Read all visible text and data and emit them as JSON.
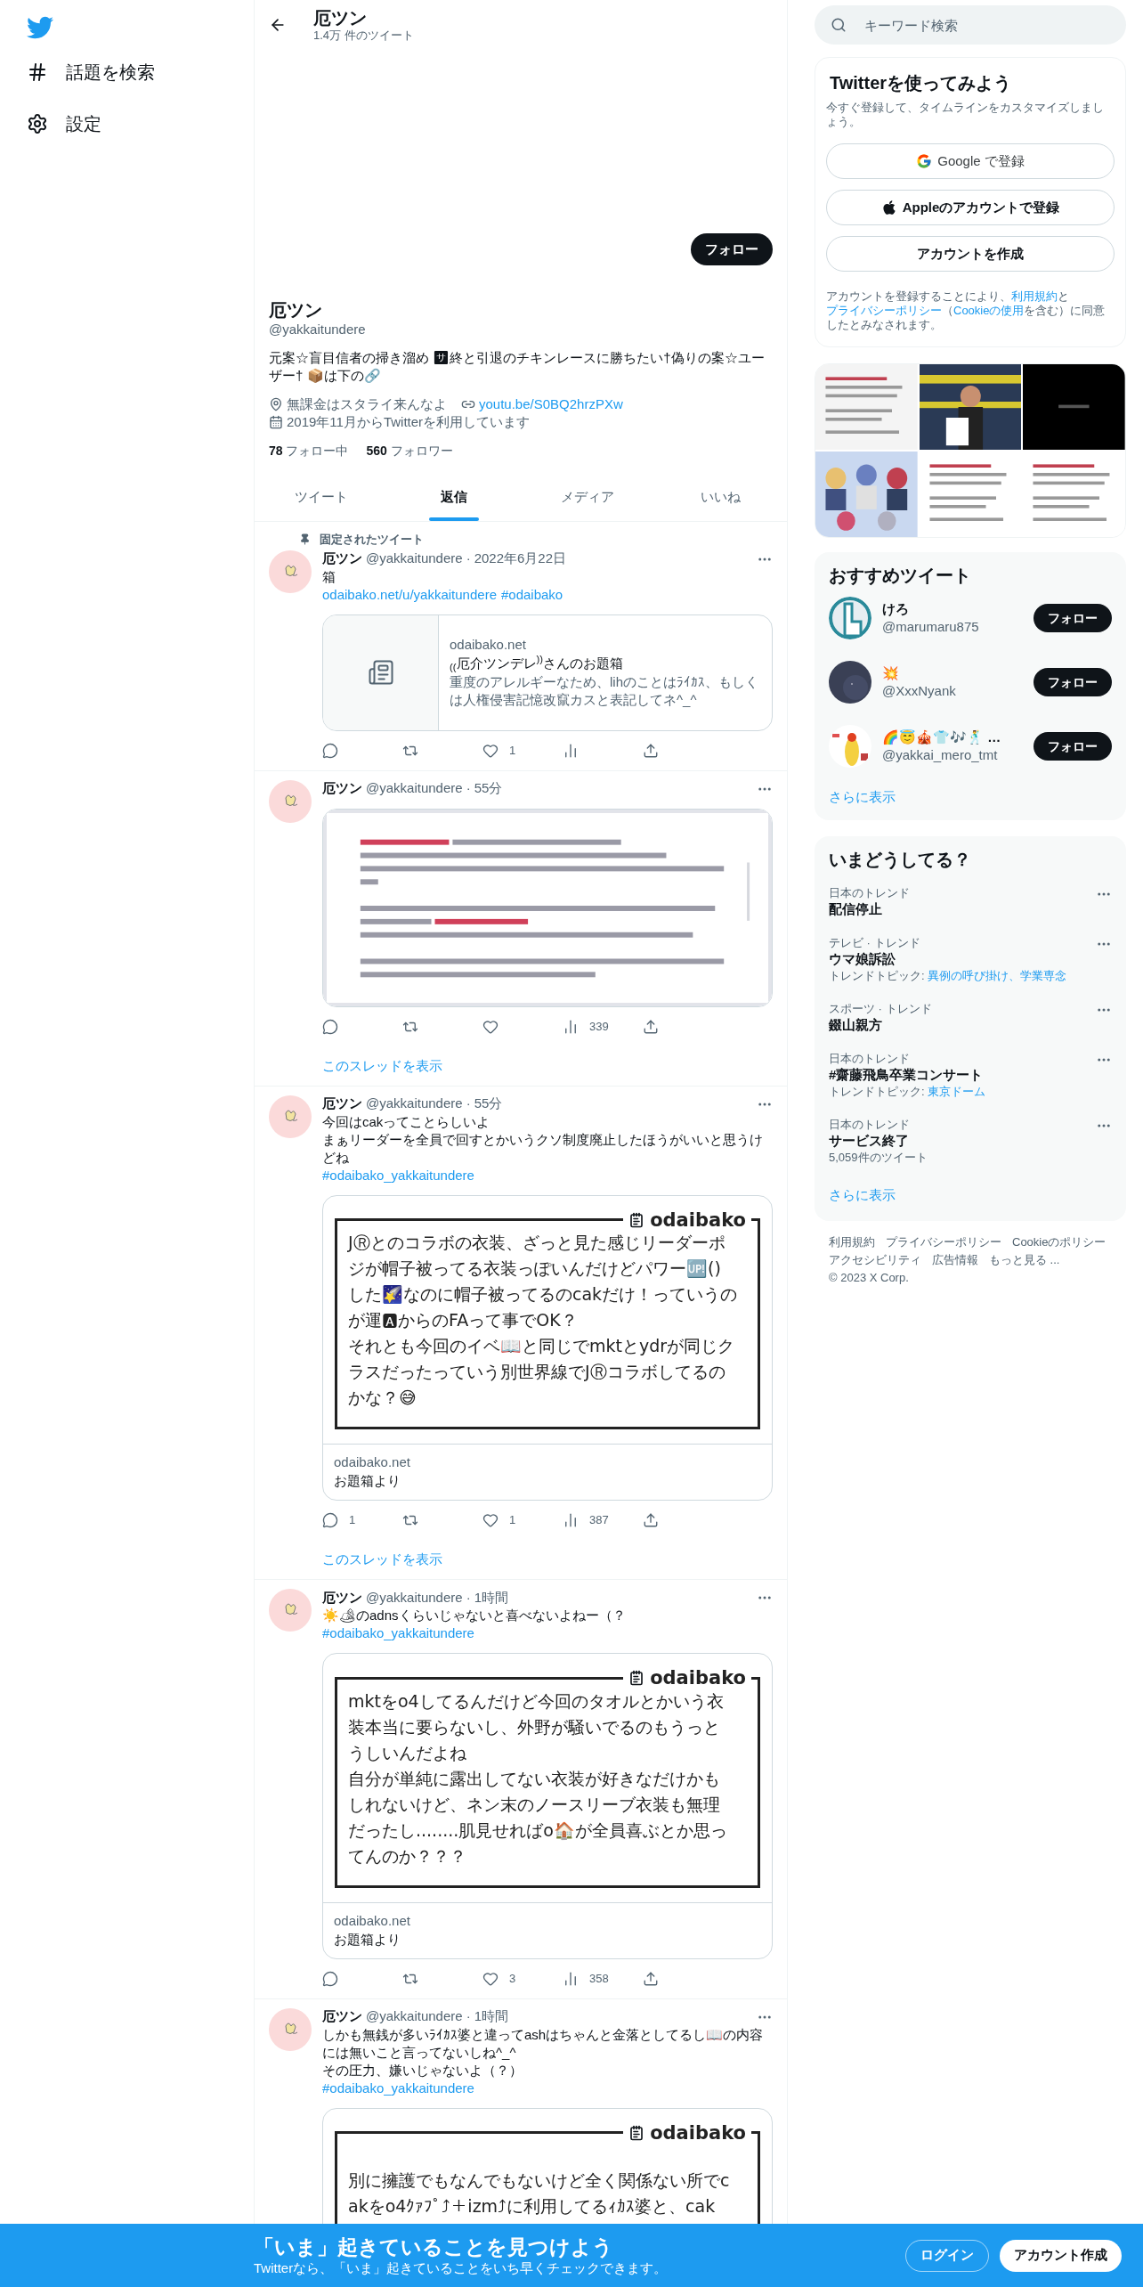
{
  "nav": {
    "items": [
      {
        "kind": "hash",
        "label": "話題を検索"
      },
      {
        "kind": "gear",
        "label": "設定"
      }
    ]
  },
  "header": {
    "title": "厄ツン",
    "subtitle": "1.4万 件のツイート"
  },
  "profile": {
    "follow_button": "フォロー",
    "name": "厄ツン",
    "handle": "@yakkaitundere",
    "bio": "元案☆盲目信者の掃き溜め 🈂終と引退のチキンレースに勝ちたい†偽りの案☆ユーザー† 📦は下の🔗",
    "location": "無課金はスタライ来んなよ",
    "link": "youtu.be/S0BQ2hrzPXw",
    "joined": "2019年11月からTwitterを利用しています",
    "stats": [
      {
        "count": "78",
        "label": "フォロー中"
      },
      {
        "count": "560",
        "label": "フォロワー"
      }
    ]
  },
  "tabs": [
    {
      "label": "ツイート",
      "selected": false
    },
    {
      "label": "返信",
      "selected": true
    },
    {
      "label": "メディア",
      "selected": false
    },
    {
      "label": "いいね",
      "selected": false
    }
  ],
  "tweets": [
    {
      "pinned_label": "固定されたツイート",
      "name": "厄ツン",
      "handle": "@yakkaitundere",
      "separator": "·",
      "time": "2022年6月22日",
      "lines": [
        "箱"
      ],
      "links": [
        "odaibako.net/u/yakkaitundere",
        "#odaibako"
      ],
      "card": {
        "kind": "link",
        "domain": "odaibako.net",
        "title": "$_{((}$厄介ツンデレ$^{))}$さんのお題箱",
        "description": "重度のアレルギーなため、lihのことはﾗｲｶｽ、もしくは人権侵害記憶改竄カスと表記してネ^_^"
      },
      "actions": [
        {
          "kind": "reply"
        },
        {
          "kind": "retweet"
        },
        {
          "kind": "like",
          "count": "1"
        },
        {
          "kind": "views"
        },
        {
          "kind": "share"
        }
      ]
    },
    {
      "name": "厄ツン",
      "handle": "@yakkaitundere",
      "separator": "·",
      "time": "55分",
      "card": {
        "kind": "picture"
      },
      "actions": [
        {
          "kind": "reply"
        },
        {
          "kind": "retweet"
        },
        {
          "kind": "like"
        },
        {
          "kind": "views",
          "count": "339"
        },
        {
          "kind": "share"
        }
      ],
      "thread_link": "このスレッドを表示"
    },
    {
      "name": "厄ツン",
      "handle": "@yakkaitundere",
      "separator": "·",
      "time": "55分",
      "lines": [
        "今回はcakってことらしいよ",
        "まぁリーダーを全員で回すとかいうクソ制度廃止したほうがいいと思うけどね"
      ],
      "hashtag": "#odaibako_yakkaitundere",
      "card": {
        "kind": "odaibako",
        "brand": "odaibako",
        "lines": [
          "JⓇとのコラボの衣装、ざっと見た感じリーダーポ",
          "ジが帽子被ってる衣装っぽいんだけどパワー🆙()",
          "した🌠なのに帽子被ってるのcakだけ！っていうの",
          "が運🅰からのFAって事でOK？",
          "それとも今回のイベ📖と同じでmktとydrが同じク",
          "ラスだったっていう別世界線でJⓇコラボしてるの",
          "かな？😅"
        ],
        "domain": "odaibako.net",
        "caption": "お題箱より"
      },
      "actions": [
        {
          "kind": "reply",
          "count": "1"
        },
        {
          "kind": "retweet"
        },
        {
          "kind": "like",
          "count": "1"
        },
        {
          "kind": "views",
          "count": "387"
        },
        {
          "kind": "share"
        }
      ],
      "thread_link": "このスレッドを表示"
    },
    {
      "name": "厄ツン",
      "handle": "@yakkaitundere",
      "separator": "·",
      "time": "1時間",
      "lines": [
        "☀️🏕のadnsくらいじゃないと喜べないよねー（？"
      ],
      "hashtag": "#odaibako_yakkaitundere",
      "card": {
        "kind": "odaibako",
        "brand": "odaibako",
        "lines": [
          "mktをo4してるんだけど今回のタオルとかいう衣",
          "装本当に要らないし、外野が騒いでるのもうっと",
          "うしいんだよね",
          "自分が単純に露出してない衣装が好きなだけかも",
          "しれないけど、ネン末のノースリーブ衣装も無理",
          "だったし........肌見せればo🏠が全員喜ぶとか思っ",
          "てんのか？？？"
        ],
        "domain": "odaibako.net",
        "caption": "お題箱より"
      },
      "actions": [
        {
          "kind": "reply"
        },
        {
          "kind": "retweet"
        },
        {
          "kind": "like",
          "count": "3"
        },
        {
          "kind": "views",
          "count": "358"
        },
        {
          "kind": "share"
        }
      ]
    },
    {
      "name": "厄ツン",
      "handle": "@yakkaitundere",
      "separator": "·",
      "time": "1時間",
      "lines": [
        "しかも無銭が多いﾗｲｶｽ婆と違ってashはちゃんと金落としてるし📖の内容には無いこと言ってないしね^_^",
        "その圧力、嫌いじゃないよ（？）"
      ],
      "hashtag": "#odaibako_yakkaitundere",
      "card": {
        "kind": "odaibako",
        "brand": "odaibako",
        "blank_first_line": true,
        "lines": [
          "別に擁護でもなんでもないけど全く関係ない所でc",
          "akをo4ｸｧﾌﾟ⤴＋izm⤴に利用してるｨｶｽ婆と、cak"
        ]
      }
    }
  ],
  "search": {
    "placeholder": "キーワード検索"
  },
  "signup": {
    "title": "Twitterを使ってみよう",
    "subtitle": "今すぐ登録して、タイムラインをカスタマイズしましょう。",
    "buttons": [
      {
        "kind": "google",
        "label": "Google で登録"
      },
      {
        "kind": "apple",
        "label": "Appleのアカウントで登録"
      },
      {
        "kind": "plain",
        "label": "アカウントを作成"
      }
    ],
    "legal": [
      {
        "text": "アカウントを登録することにより、",
        "link": false
      },
      {
        "text": "利用規約",
        "link": true
      },
      {
        "text": "と",
        "link": false
      },
      {
        "text": "プライバシーポリシー",
        "link": true
      },
      {
        "text": "（",
        "link": false
      },
      {
        "text": "Cookieの使用",
        "link": true
      },
      {
        "text": "を含む）に同意したとみなされます。",
        "link": false
      }
    ]
  },
  "media": [
    {
      "kind": "picture"
    },
    {
      "kind": "picture"
    },
    {
      "kind": "picture"
    },
    {
      "kind": "picture"
    },
    {
      "kind": "picture"
    },
    {
      "kind": "picture"
    }
  ],
  "who_to_follow": {
    "title": "おすすめツイート",
    "more": "さらに表示",
    "users": [
      {
        "name": "けろ",
        "handle": "@marumaru875",
        "button": "フォロー"
      },
      {
        "name": "💥",
        "handle": "@XxxNyank",
        "button": "フォロー"
      },
      {
        "name": "🌈😇🎪👕🎶🕺 …",
        "handle": "@yakkai_mero_tmt",
        "button": "フォロー"
      }
    ]
  },
  "trends": {
    "title": "いまどうしてる？",
    "more": "さらに表示",
    "items": [
      {
        "context": "日本のトレンド",
        "topic": "配信停止"
      },
      {
        "context": "テレビ · トレンド",
        "topic": "ウマ娘訴訟",
        "related_label": "トレンドトピック:",
        "related": "異例の呼び掛け、学業専念"
      },
      {
        "context": "スポーツ · トレンド",
        "topic": "錣山親方"
      },
      {
        "context": "日本のトレンド",
        "topic": "#齋藤飛鳥卒業コンサート",
        "related_label": "トレンドトピック:",
        "related": "東京ドーム"
      },
      {
        "context": "日本のトレンド",
        "topic": "サービス終了",
        "meta": "5,059件のツイート"
      }
    ]
  },
  "footer": {
    "links": [
      "利用規約",
      "プライバシーポリシー",
      "Cookieのポリシー",
      "アクセシビリティ",
      "広告情報",
      "もっと見る ..."
    ],
    "copyright": "© 2023 X Corp."
  },
  "bottom_bar": {
    "title": "「いま」起きていることを見つけよう",
    "subtitle": "Twitterなら、「いま」起きていることをいち早くチェックできます。",
    "buttons": [
      {
        "kind": "outline",
        "label": "ログイン"
      },
      {
        "kind": "filled",
        "label": "アカウント作成"
      }
    ]
  }
}
